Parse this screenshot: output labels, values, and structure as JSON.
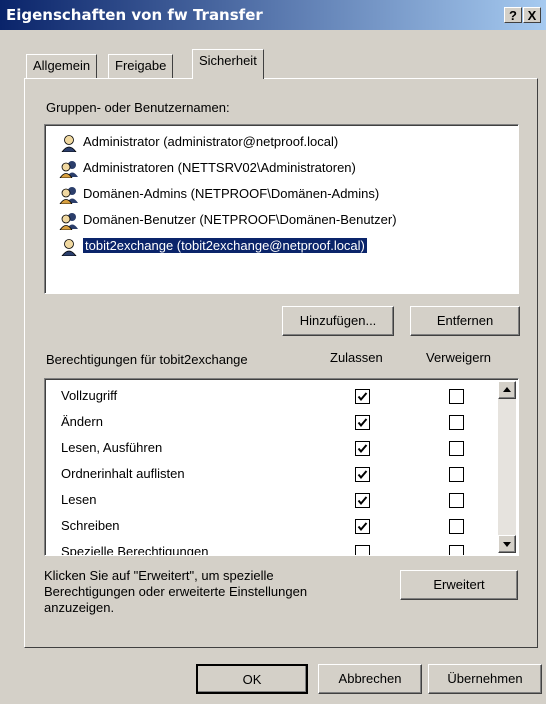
{
  "window": {
    "title": "Eigenschaften von fw Transfer",
    "help_btn": "?",
    "close_btn": "X"
  },
  "tabs": [
    {
      "label": "Allgemein"
    },
    {
      "label": "Freigabe"
    },
    {
      "label": "Sicherheit"
    }
  ],
  "groups": {
    "label": "Gruppen- oder Benutzernamen:",
    "items": [
      {
        "name": "Administrator (administrator@netproof.local)",
        "icon": "user-icon"
      },
      {
        "name": "Administratoren (NETTSRV02\\Administratoren)",
        "icon": "group-icon"
      },
      {
        "name": "Domänen-Admins (NETPROOF\\Domänen-Admins)",
        "icon": "group-icon"
      },
      {
        "name": "Domänen-Benutzer (NETPROOF\\Domänen-Benutzer)",
        "icon": "group-icon"
      },
      {
        "name": "tobit2exchange (tobit2exchange@netproof.local)",
        "icon": "user-icon",
        "selected": true
      }
    ]
  },
  "buttons": {
    "add": "Hinzufügen...",
    "remove": "Entfernen",
    "advanced": "Erweitert",
    "ok": "OK",
    "cancel": "Abbrechen",
    "apply": "Übernehmen"
  },
  "permissions": {
    "label": "Berechtigungen für tobit2exchange",
    "col_allow": "Zulassen",
    "col_deny": "Verweigern",
    "rows": [
      {
        "name": "Vollzugriff",
        "allow": true,
        "deny": false
      },
      {
        "name": "Ändern",
        "allow": true,
        "deny": false
      },
      {
        "name": "Lesen, Ausführen",
        "allow": true,
        "deny": false
      },
      {
        "name": "Ordnerinhalt auflisten",
        "allow": true,
        "deny": false
      },
      {
        "name": "Lesen",
        "allow": true,
        "deny": false
      },
      {
        "name": "Schreiben",
        "allow": true,
        "deny": false
      },
      {
        "name": "Spezielle Berechtigungen",
        "allow": false,
        "deny": false
      }
    ]
  },
  "advanced_hint": "Klicken Sie auf \"Erweitert\", um spezielle Berechtigungen oder erweiterte Einstellungen anzuzeigen."
}
